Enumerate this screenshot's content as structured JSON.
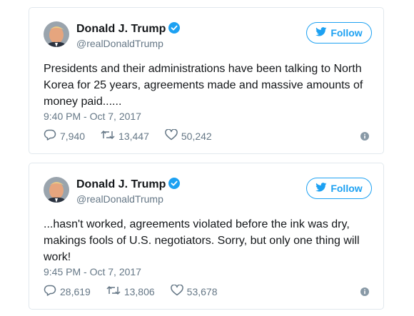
{
  "tweets": [
    {
      "name": "Donald J. Trump",
      "handle": "@realDonaldTrump",
      "follow_label": "Follow",
      "text": "Presidents and their administrations have been talking to North Korea for 25 years, agreements made and massive amounts of money paid......",
      "time": "9:40 PM - Oct 7, 2017",
      "replies": "7,940",
      "retweets": "13,447",
      "likes": "50,242"
    },
    {
      "name": "Donald J. Trump",
      "handle": "@realDonaldTrump",
      "follow_label": "Follow",
      "text": "...hasn't worked, agreements violated before the ink was dry, makings fools of U.S. negotiators. Sorry, but only one thing will work!",
      "time": "9:45 PM - Oct 7, 2017",
      "replies": "28,619",
      "retweets": "13,806",
      "likes": "53,678"
    }
  ],
  "colors": {
    "accent": "#1da1f2",
    "text": "#14171a",
    "muted": "#657786",
    "border": "#e1e8ed"
  },
  "icons": [
    "verified-badge-icon",
    "twitter-bird-icon",
    "reply-icon",
    "retweet-icon",
    "like-heart-icon",
    "info-icon"
  ]
}
